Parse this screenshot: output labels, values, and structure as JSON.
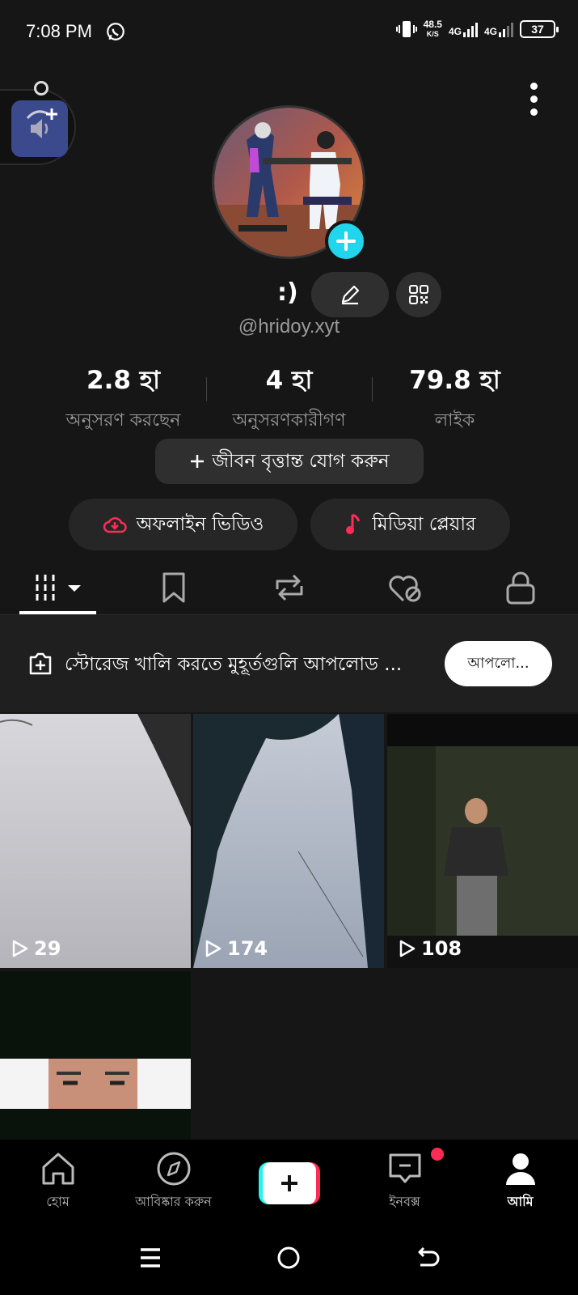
{
  "status_bar": {
    "time": "7:08 PM",
    "speed_value": "48.5",
    "speed_unit": "K/S",
    "network_1": "4G",
    "network_2": "4G",
    "battery": "37"
  },
  "profile": {
    "nickname": ":)",
    "username": "@hridoy.xyt",
    "stats": [
      {
        "value": "2.8 হা",
        "label": "অনুসরণ করছেন"
      },
      {
        "value": "4 হা",
        "label": "অনুসরণকারীগণ"
      },
      {
        "value": "79.8 হা",
        "label": "লাইক"
      }
    ],
    "bio_button": "জীবন বৃত্তান্ত যোগ করুন",
    "offline_video": "অফলাইন ভিডিও",
    "media_player": "মিডিয়া প্লেয়ার"
  },
  "tabs": [
    {
      "icon": "videos-grid-icon"
    },
    {
      "icon": "bookmark-icon"
    },
    {
      "icon": "repost-icon"
    },
    {
      "icon": "liked-hidden-icon"
    },
    {
      "icon": "lock-icon"
    }
  ],
  "upload_banner": {
    "text": "স্টোরেজ খালি করতে মুহূর্তগুলি আপলোড ...",
    "button": "আপলো..."
  },
  "videos": [
    {
      "views": "29"
    },
    {
      "views": "174"
    },
    {
      "views": "108"
    },
    {
      "views": ""
    }
  ],
  "bottom_nav": [
    {
      "label": "হোম"
    },
    {
      "label": "আবিষ্কার করুন"
    },
    {
      "label": ""
    },
    {
      "label": "ইনবক্স"
    },
    {
      "label": "আমি"
    }
  ],
  "colors": {
    "accent_cyan": "#20d5ec",
    "accent_red": "#fe2c55",
    "background": "#161616"
  }
}
